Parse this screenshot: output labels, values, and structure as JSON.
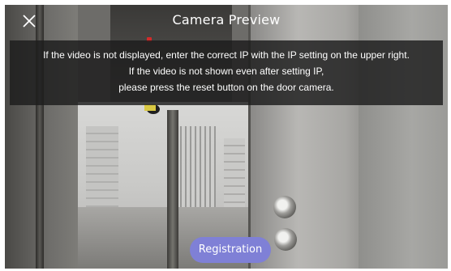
{
  "header": {
    "title": "Camera Preview",
    "close_icon": "close-icon"
  },
  "notice": {
    "lines": [
      "If the video is not displayed, enter the correct IP with the IP setting on the upper right.",
      "If  the video is not shown even after setting IP,",
      "please press the reset button on the door camera."
    ]
  },
  "actions": {
    "registration_label": "Registration"
  },
  "colors": {
    "button_accent": "#7f80d6",
    "notice_background": "#1c1c1c",
    "text": "#ffffff"
  }
}
